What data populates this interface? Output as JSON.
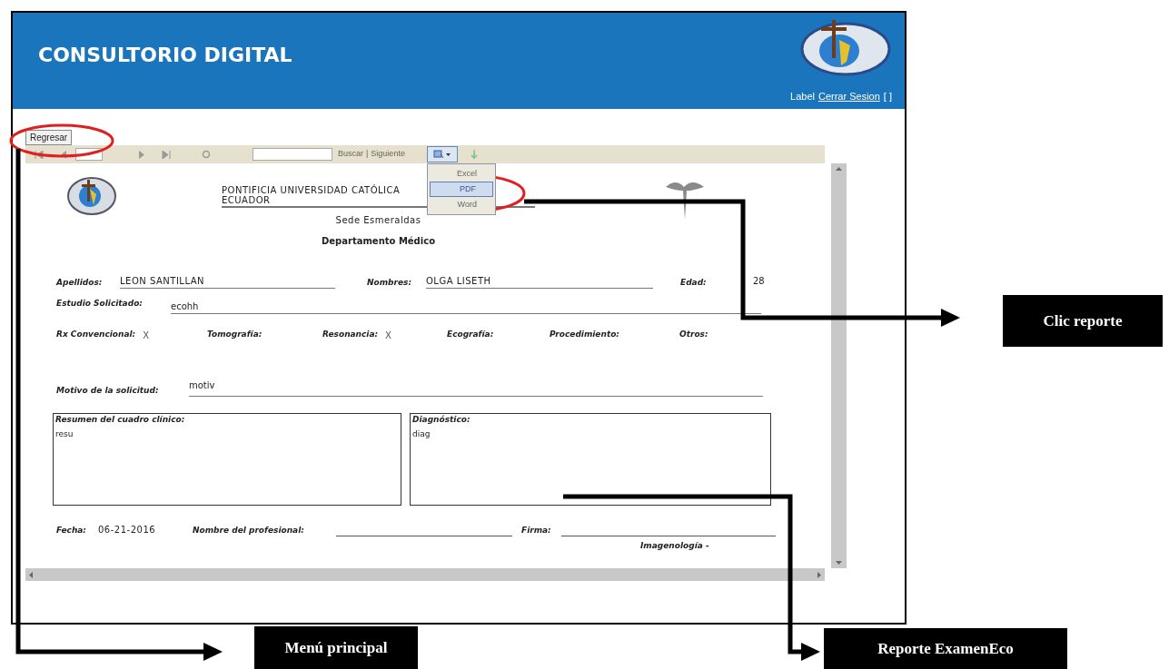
{
  "header": {
    "title": "CONSULTORIO DIGITAL",
    "user_label": "Label",
    "logout_link": "Cerrar Sesion",
    "bracket": "[ ]"
  },
  "back_button": "Regresar",
  "toolbar": {
    "find_link": "Buscar",
    "separator": "|",
    "next_link": "Siguiente",
    "export_menu": {
      "expanded": true,
      "items": [
        {
          "label": "Excel",
          "selected": false
        },
        {
          "label": "PDF",
          "selected": true
        },
        {
          "label": "Word",
          "selected": false
        }
      ]
    }
  },
  "report": {
    "institution_line_1": "PONTIFICIA UNIVERSIDAD CATÓLICA",
    "institution_line_2": "ECUADOR",
    "campus": "Sede Esmeraldas",
    "department": "Departamento Médico",
    "surname_label": "Apellidos:",
    "surname": "LEON SANTILLAN",
    "names_label": "Nombres:",
    "names": "OLGA LISETH",
    "age_label": "Edad:",
    "age": "28",
    "study_label": "Estudio Solicitado:",
    "study": "ecohh",
    "exam_types": [
      {
        "label": "Rx Convencional:",
        "mark": "X"
      },
      {
        "label": "Tomografía:"
      },
      {
        "label": "Resonancia:",
        "mark": "X"
      },
      {
        "label": "Ecografía:"
      },
      {
        "label": "Procedimiento:"
      },
      {
        "label": "Otros:"
      }
    ],
    "reason_label": "Motivo de la solicitud:",
    "reason": "motiv",
    "summary_label": "Resumen del cuadro clínico:",
    "summary": "resu",
    "diagnosis_label": "Diagnóstico:",
    "diagnosis": "diag",
    "date_label": "Fecha:",
    "date": "06-21-2016",
    "professional_label": "Nombre del profesional:",
    "signature_label": "Firma:",
    "footer": "Imagenología -"
  },
  "annotations": [
    {
      "text": "Clic reporte"
    },
    {
      "text": "Menú principal"
    },
    {
      "text": "Reporte ExamenEco"
    }
  ]
}
